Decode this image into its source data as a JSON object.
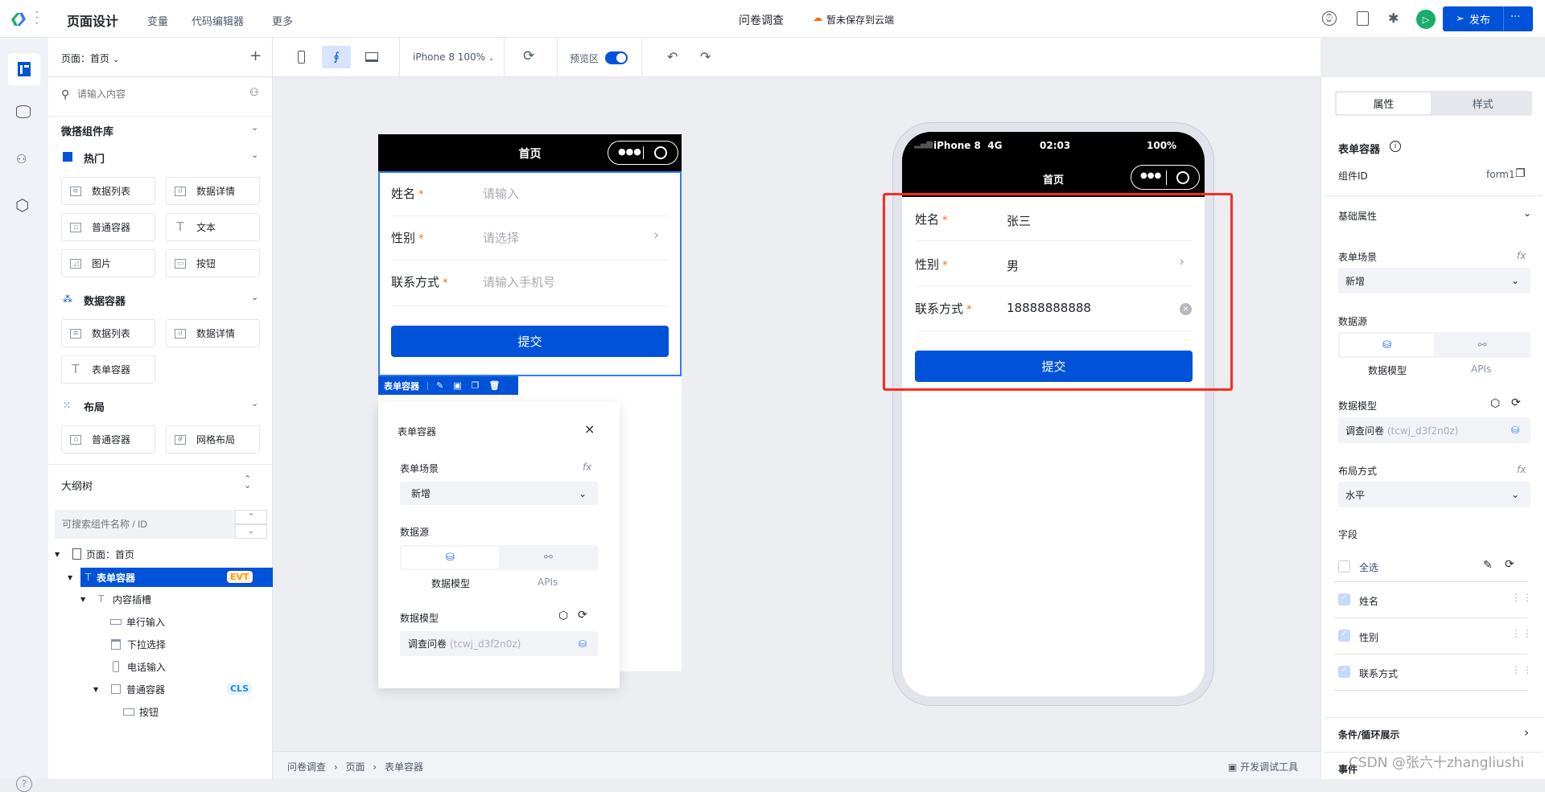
{
  "topbar": {
    "app_title": "页面设计",
    "nav": [
      "变量",
      "代码编辑器",
      "更多"
    ],
    "doc_title": "问卷调查",
    "save_status": "暂未保存到云端",
    "publish_label": "发布",
    "more_label": "···"
  },
  "toolbar": {
    "page_selector": "页面：首页",
    "add_label": "+",
    "device": "iPhone 8 100%",
    "preview_label": "预览区",
    "preview_on": true
  },
  "left": {
    "search_placeholder": "请输入内容",
    "library_title": "微搭组件库",
    "groups": [
      {
        "title": "热门",
        "items": [
          "数据列表",
          "数据详情",
          "普通容器",
          "文本",
          "图片",
          "按钮"
        ]
      },
      {
        "title": "数据容器",
        "items": [
          "数据列表",
          "数据详情",
          "表单容器"
        ]
      },
      {
        "title": "布局",
        "items": [
          "普通容器",
          "网格布局"
        ]
      }
    ],
    "outline_title": "大纲树",
    "outline_search_placeholder": "可搜索组件名称 / ID",
    "tree": [
      {
        "label": "页面：首页"
      },
      {
        "label": "表单容器",
        "badge": "EVT",
        "selected": true
      },
      {
        "label": "内容插槽"
      },
      {
        "label": "单行输入"
      },
      {
        "label": "下拉选择"
      },
      {
        "label": "电话输入"
      },
      {
        "label": "普通容器",
        "badge": "CLS"
      },
      {
        "label": "按钮"
      }
    ]
  },
  "preview": {
    "nav_title": "首页",
    "fields": [
      {
        "label": "姓名",
        "placeholder": "请输入"
      },
      {
        "label": "性别",
        "placeholder": "请选择"
      },
      {
        "label": "联系方式",
        "placeholder": "请输入手机号"
      }
    ],
    "submit": "提交",
    "selection_label": "表单容器"
  },
  "popup": {
    "title": "表单容器",
    "scene_label": "表单场景",
    "scene_value": "新增",
    "datasource_label": "数据源",
    "ds_options": [
      "数据模型",
      "APIs"
    ],
    "model_label": "数据模型",
    "model_value": "调查问卷",
    "model_id": "(tcwj_d3f2n0z)",
    "fx": "fx"
  },
  "phone": {
    "carrier": "iPhone 8  4G",
    "time": "02:03",
    "battery": "100%",
    "nav_title": "首页",
    "fields": [
      {
        "label": "姓名",
        "value": "张三"
      },
      {
        "label": "性别",
        "value": "男"
      },
      {
        "label": "联系方式",
        "value": "18888888888"
      }
    ],
    "submit": "提交"
  },
  "right": {
    "tabs": [
      "属性",
      "样式"
    ],
    "component_title": "表单容器",
    "id_label": "组件ID",
    "id_value": "form1",
    "basic_section": "基础属性",
    "scene_label": "表单场景",
    "scene_value": "新增",
    "datasource_label": "数据源",
    "ds_options": [
      "数据模型",
      "APIs"
    ],
    "model_label": "数据模型",
    "model_value": "调查问卷",
    "model_id": "(tcwj_d3f2n0z)",
    "layout_label": "布局方式",
    "layout_value": "水平",
    "fields_label": "字段",
    "select_all": "全选",
    "fields": [
      "姓名",
      "性别",
      "联系方式"
    ],
    "cond_section": "条件/循环展示",
    "event_section": "事件",
    "fx": "fx"
  },
  "breadcrumb": [
    "问卷调查",
    "页面",
    "表单容器"
  ],
  "devtools_label": "开发调试工具",
  "watermark": "CSDN @张六十zhangliushi",
  "colors": {
    "primary": "#0052d9",
    "play": "#1aad6c",
    "highlight": "#ff2a1f",
    "required": "#f56c18"
  }
}
